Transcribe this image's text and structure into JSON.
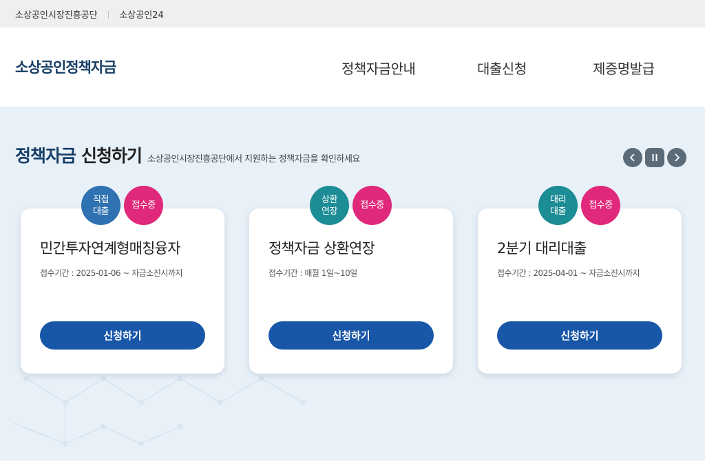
{
  "topbar": {
    "links": [
      "소상공인시장진흥공단",
      "소상공인24"
    ],
    "separator": "|"
  },
  "header": {
    "logo": "소상공인정책자금",
    "nav": [
      "정책자금안내",
      "대출신청",
      "제증명발급"
    ]
  },
  "section": {
    "title_highlight": "정책자금",
    "title_rest": "신청하기",
    "subtitle": "소상공인시장진흥공단에서 지원하는 정책자금을 확인하세요"
  },
  "slider_controls": {
    "prev_icon": "chevron-left-icon",
    "pause_icon": "pause-icon",
    "next_icon": "chevron-right-icon"
  },
  "cards": [
    {
      "type_line1": "직접",
      "type_line2": "대출",
      "status": "접수중",
      "title": "민간투자연계형매칭융자",
      "period": "접수기간 : 2025-01-06 ~ 자금소진시까지",
      "button": "신청하기"
    },
    {
      "type_line1": "상환",
      "type_line2": "연장",
      "status": "접수중",
      "title": "정책자금 상환연장",
      "period": "접수기간 : 매월 1일~10일",
      "button": "신청하기"
    },
    {
      "type_line1": "대리",
      "type_line2": "대출",
      "status": "접수중",
      "title": "2분기 대리대출",
      "period": "접수기간 : 2025-04-01 ~ 자금소진시까지",
      "button": "신청하기"
    }
  ],
  "colors": {
    "brand_navy": "#163e66",
    "button_blue": "#1856a8",
    "badge_blue": "#2f72b2",
    "badge_teal": "#1c8c95",
    "badge_pink": "#e0297a",
    "page_bg": "#e9f1f8"
  }
}
